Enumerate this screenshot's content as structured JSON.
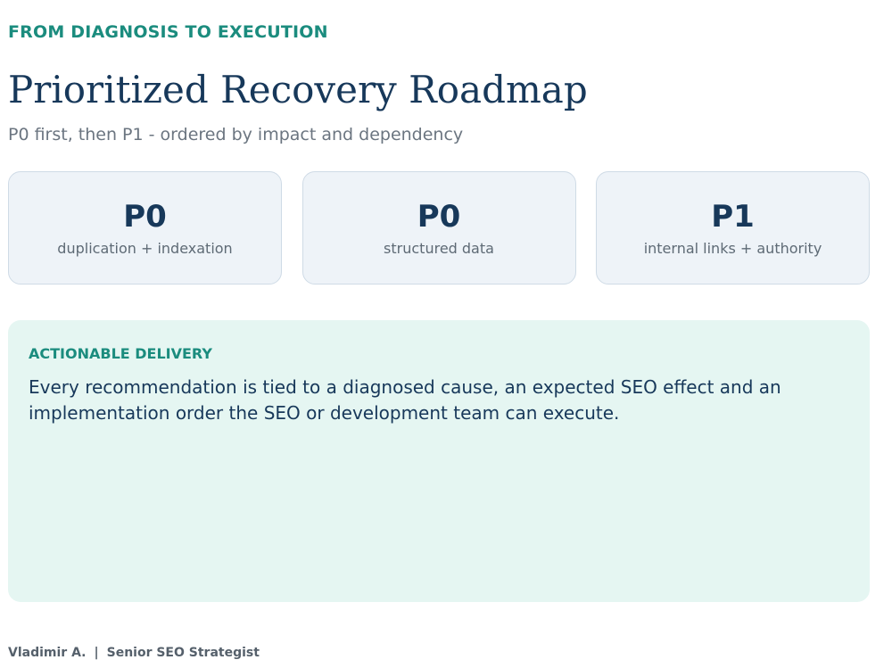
{
  "header": {
    "eyebrow": "FROM DIAGNOSIS TO EXECUTION",
    "title": "Prioritized Recovery Roadmap",
    "subtitle": "P0 first, then P1 - ordered by impact and dependency"
  },
  "priorities": [
    {
      "level": "P0",
      "description": "duplication + indexation"
    },
    {
      "level": "P0",
      "description": "structured data"
    },
    {
      "level": "P1",
      "description": "internal links + authority"
    }
  ],
  "delivery": {
    "label": "ACTIONABLE DELIVERY",
    "text": "Every recommendation is tied to a diagnosed cause, an expected SEO effect and an implementation order the SEO or development team can execute."
  },
  "footer": {
    "author": "Vladimir A.",
    "separator": "|",
    "role": "Senior SEO Strategist"
  },
  "colors": {
    "accent": "#1b8c7e",
    "heading": "#17385a",
    "card_bg": "#eef3f8",
    "delivery_bg": "#e5f6f2"
  }
}
